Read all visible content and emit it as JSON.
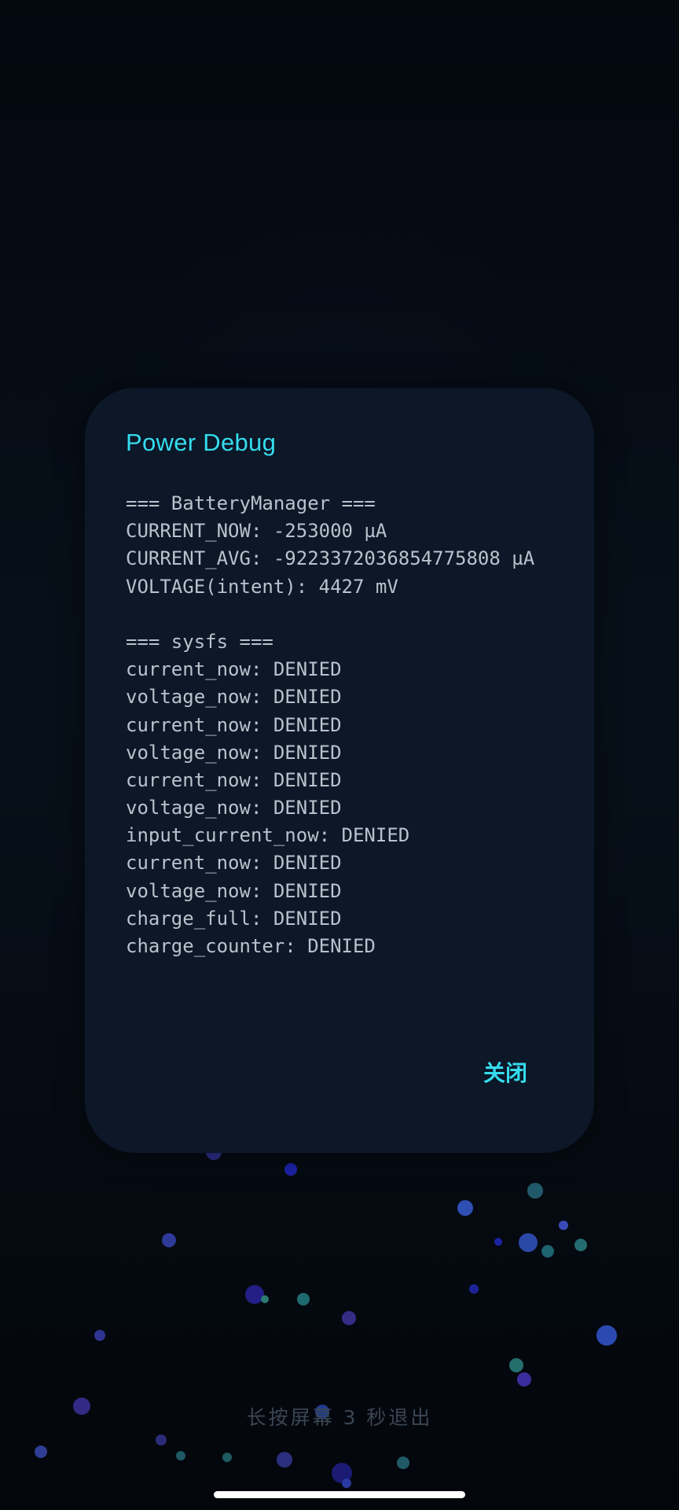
{
  "dialog": {
    "title": "Power Debug",
    "lines": [
      "=== BatteryManager ===",
      "CURRENT_NOW: -253000 µA",
      "CURRENT_AVG: -9223372036854775808 µA",
      "VOLTAGE(intent): 4427 mV",
      "",
      "=== sysfs ===",
      "current_now: DENIED",
      "voltage_now: DENIED",
      "current_now: DENIED",
      "voltage_now: DENIED",
      "current_now: DENIED",
      "voltage_now: DENIED",
      "input_current_now: DENIED",
      "current_now: DENIED",
      "voltage_now: DENIED",
      "charge_full: DENIED",
      "charge_counter: DENIED"
    ],
    "close_label": "关闭"
  },
  "exit_hint": "长按屏幕 3 秒退出",
  "colors": {
    "accent": "#35dced",
    "dialog_background": "#0c1727",
    "screen_background": "#050a12",
    "debug_text": "#b9c2cc"
  }
}
